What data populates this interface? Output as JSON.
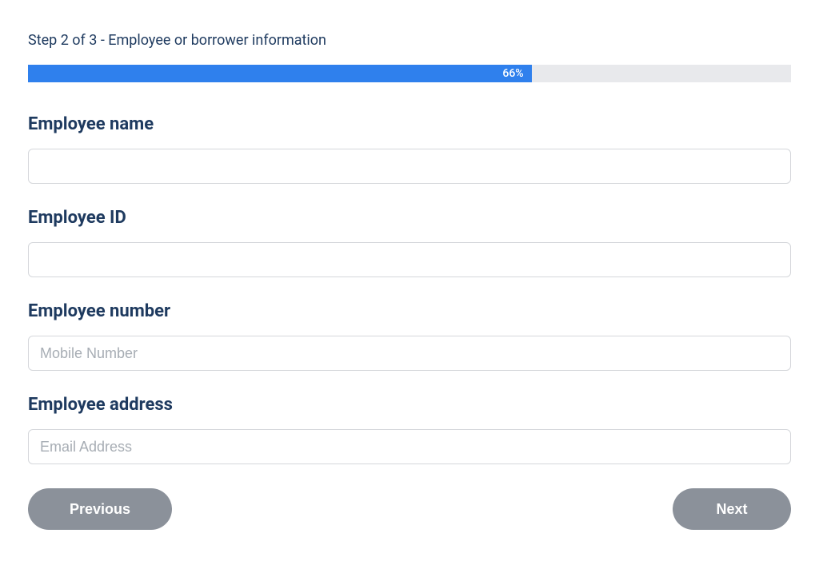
{
  "step": {
    "label": "Step 2 of 3 - Employee or borrower information",
    "progress_percent": 66,
    "progress_width": "66%",
    "progress_text": "66%"
  },
  "fields": {
    "name": {
      "label": "Employee name",
      "value": "",
      "placeholder": ""
    },
    "id": {
      "label": "Employee ID",
      "value": "",
      "placeholder": ""
    },
    "number": {
      "label": "Employee number",
      "value": "",
      "placeholder": "Mobile Number"
    },
    "address": {
      "label": "Employee address",
      "value": "",
      "placeholder": "Email Address"
    }
  },
  "buttons": {
    "previous": "Previous",
    "next": "Next"
  }
}
